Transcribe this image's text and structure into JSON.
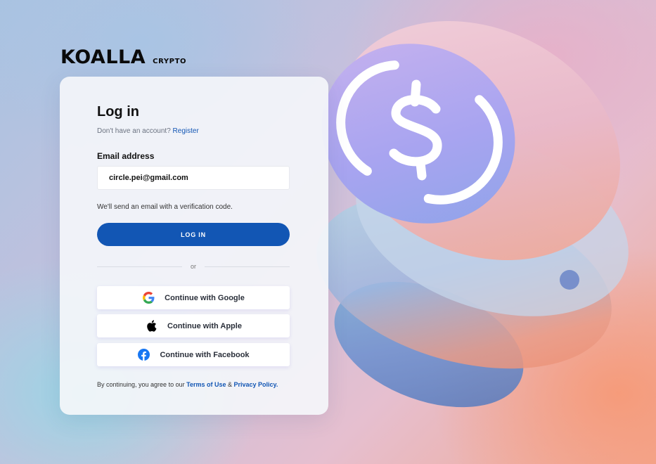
{
  "brand": {
    "name": "KOALLA",
    "sub": "CRYPTO"
  },
  "login": {
    "title": "Log in",
    "register_prompt": "Don't have an account?",
    "register_link": "Register",
    "email_label": "Email address",
    "email_value": "circle.pei@gmail.com",
    "hint": "We'll send an email with a verification code.",
    "login_button": "LOG IN",
    "divider_text": "or",
    "social": {
      "google": {
        "label": "Continue with Google",
        "icon": "google-icon"
      },
      "apple": {
        "label": "Continue with Apple",
        "icon": "apple-icon"
      },
      "facebook": {
        "label": "Continue with Facebook",
        "icon": "facebook-icon"
      }
    },
    "terms": {
      "prefix": "By continuing, you agree to our",
      "terms_link": "Terms of Use",
      "amp": "&",
      "privacy_link": "Privacy Policy."
    }
  },
  "colors": {
    "accent": "#1256b4",
    "coin_purple": "#a8a4f0",
    "background_peach": "#f2a993"
  }
}
